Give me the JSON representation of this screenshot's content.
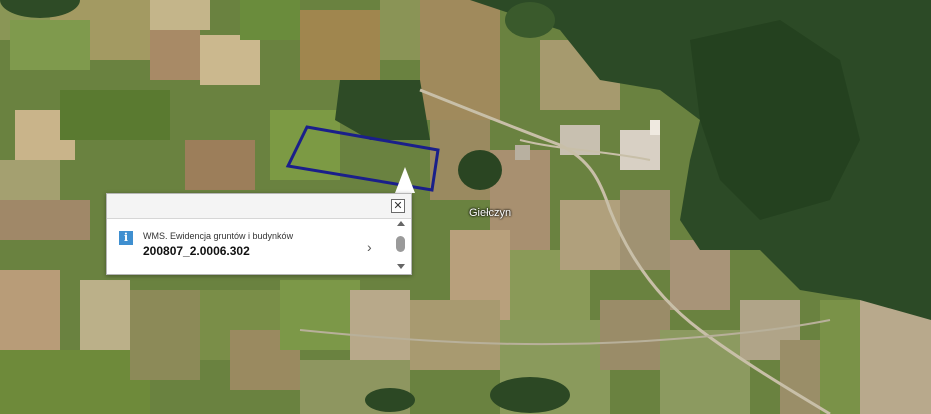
{
  "map": {
    "place_label": "Giełczyn"
  },
  "popup": {
    "layer_name": "WMS. Ewidencja gruntów i budynków",
    "parcel_id": "200807_2.0006.302",
    "close_glyph": "✕",
    "info_glyph": "i",
    "next_glyph": "›"
  },
  "colors": {
    "parcel_outline": "#1a1f8a",
    "info_icon": "#3f8fd0"
  },
  "icons": [
    "close-icon",
    "info-icon",
    "chevron-right-icon",
    "scroll-up-icon",
    "scroll-down-icon"
  ]
}
